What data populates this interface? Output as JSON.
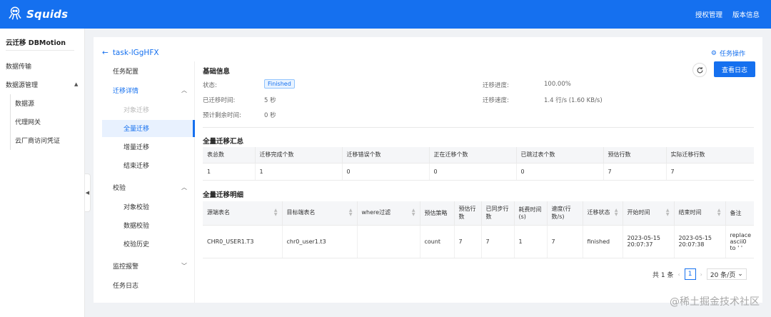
{
  "app": {
    "brand": "Squids"
  },
  "topnav": {
    "auth": "授权管理",
    "version": "版本信息"
  },
  "sidebar": {
    "title": "云迁移 DBMotion",
    "items": [
      "数据传输",
      "数据源管理"
    ],
    "subitems": [
      "数据源",
      "代理网关",
      "云厂商访问凭证"
    ]
  },
  "task": {
    "back_title": "task-lGgHFX",
    "ops_label": "任务操作"
  },
  "menu": {
    "config": "任务配置",
    "detail": "迁移详情",
    "detail_items": [
      "对象迁移",
      "全量迁移",
      "增量迁移",
      "结束迁移"
    ],
    "verify": "校验",
    "verify_items": [
      "对象校验",
      "数据校验",
      "校验历史"
    ],
    "monitor": "监控报警",
    "log": "任务日志"
  },
  "basic": {
    "title": "基础信息",
    "status_label": "状态:",
    "status_value": "Finished",
    "elapsed_label": "已迁移时间:",
    "elapsed_value": "5 秒",
    "remain_label": "预计剩余时间:",
    "remain_value": "0 秒",
    "progress_label": "迁移进度:",
    "progress_value": "100.00%",
    "speed_label": "迁移速度:",
    "speed_value": "1.4 行/s (1.60 KB/s)",
    "log_button": "查看日志"
  },
  "summary": {
    "title": "全量迁移汇总",
    "headers": [
      "表总数",
      "迁移完成个数",
      "迁移错误个数",
      "正在迁移个数",
      "已跳过表个数",
      "预估行数",
      "实际迁移行数"
    ],
    "row": [
      "1",
      "1",
      "0",
      "0",
      "0",
      "7",
      "7"
    ]
  },
  "detail": {
    "title": "全量迁移明细",
    "headers": [
      "源端表名",
      "目标端表名",
      "where过滤",
      "预估策略",
      "预估行数",
      "已同步行数",
      "耗费时间(s)",
      "速度(行数/s)",
      "迁移状态",
      "开始时间",
      "结束时间",
      "备注"
    ],
    "row": [
      "CHR0_USER1.T3",
      "chr0_user1.t3",
      "",
      "count",
      "7",
      "7",
      "1",
      "7",
      "finished",
      "2023-05-15 20:07:37",
      "2023-05-15 20:07:38",
      "replace ascii0 to ' '"
    ]
  },
  "pager": {
    "total": "共 1 条",
    "page": "1",
    "size": "20 条/页"
  },
  "watermark": "@稀土掘金技术社区"
}
